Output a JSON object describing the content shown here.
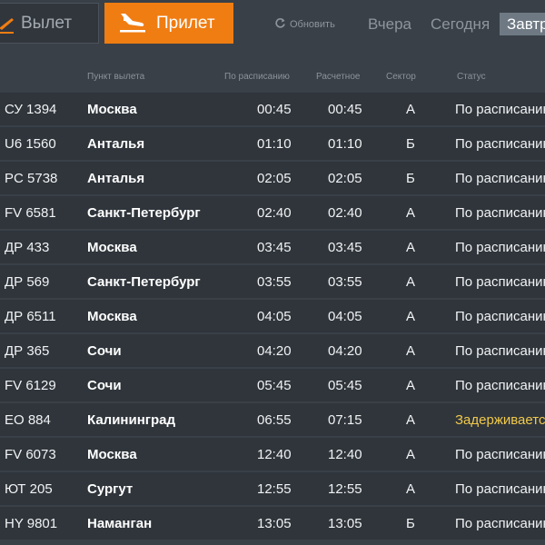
{
  "tabs": {
    "departures_label": "Вылет",
    "arrivals_label": "Прилет"
  },
  "refresh_label": "Обновить",
  "days": {
    "yesterday": "Вчера",
    "today": "Сегодня",
    "tomorrow": "Завтра"
  },
  "columns": {
    "origin": "Пункт вылета",
    "scheduled": "По расписанию",
    "estimated": "Расчетное",
    "sector": "Сектор",
    "status": "Статус"
  },
  "colors": {
    "accent": "#f07d12",
    "delayed": "#f2c94c",
    "row_bg": "#2f353b",
    "page_bg": "#3a4047"
  },
  "icons": {
    "departures": "plane-takeoff-icon",
    "arrivals": "plane-landing-icon",
    "refresh": "refresh-icon"
  },
  "flights": [
    {
      "flight": "СУ 1394",
      "city": "Москва",
      "scheduled": "00:45",
      "estimated": "00:45",
      "sector": "А",
      "status": "По расписанию",
      "delayed": false
    },
    {
      "flight": "U6 1560",
      "city": "Анталья",
      "scheduled": "01:10",
      "estimated": "01:10",
      "sector": "Б",
      "status": "По расписанию",
      "delayed": false
    },
    {
      "flight": "PC 5738",
      "city": "Анталья",
      "scheduled": "02:05",
      "estimated": "02:05",
      "sector": "Б",
      "status": "По расписанию",
      "delayed": false
    },
    {
      "flight": "FV 6581",
      "city": "Санкт-Петербург",
      "scheduled": "02:40",
      "estimated": "02:40",
      "sector": "А",
      "status": "По расписанию",
      "delayed": false
    },
    {
      "flight": "ДР 433",
      "city": "Москва",
      "scheduled": "03:45",
      "estimated": "03:45",
      "sector": "А",
      "status": "По расписанию",
      "delayed": false
    },
    {
      "flight": "ДР 569",
      "city": "Санкт-Петербург",
      "scheduled": "03:55",
      "estimated": "03:55",
      "sector": "А",
      "status": "По расписанию",
      "delayed": false
    },
    {
      "flight": "ДР 6511",
      "city": "Москва",
      "scheduled": "04:05",
      "estimated": "04:05",
      "sector": "А",
      "status": "По расписанию",
      "delayed": false
    },
    {
      "flight": "ДР 365",
      "city": "Сочи",
      "scheduled": "04:20",
      "estimated": "04:20",
      "sector": "А",
      "status": "По расписанию",
      "delayed": false
    },
    {
      "flight": "FV 6129",
      "city": "Сочи",
      "scheduled": "05:45",
      "estimated": "05:45",
      "sector": "А",
      "status": "По расписанию",
      "delayed": false
    },
    {
      "flight": "ЕО 884",
      "city": "Калининград",
      "scheduled": "06:55",
      "estimated": "07:15",
      "sector": "А",
      "status": "Задерживается",
      "delayed": true
    },
    {
      "flight": "FV 6073",
      "city": "Москва",
      "scheduled": "12:40",
      "estimated": "12:40",
      "sector": "А",
      "status": "По расписанию",
      "delayed": false
    },
    {
      "flight": "ЮТ 205",
      "city": "Сургут",
      "scheduled": "12:55",
      "estimated": "12:55",
      "sector": "А",
      "status": "По расписанию",
      "delayed": false
    },
    {
      "flight": "HY 9801",
      "city": "Наманган",
      "scheduled": "13:05",
      "estimated": "13:05",
      "sector": "Б",
      "status": "По расписанию",
      "delayed": false
    }
  ]
}
